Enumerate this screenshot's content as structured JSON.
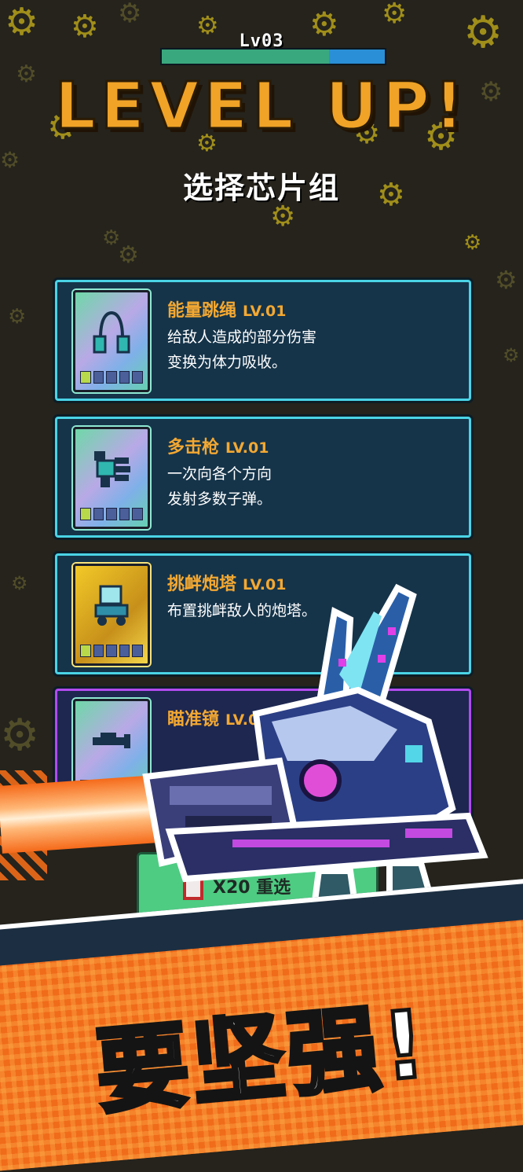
{
  "header": {
    "level_label": "Lv03",
    "xp_progress": 0.75,
    "title": "LEVEL UP!",
    "subtitle": "选择芯片组"
  },
  "cards": [
    {
      "name": "能量跳绳",
      "level": "LV.01",
      "desc_line1": "给敌人造成的部分伤害",
      "desc_line2": "变换为体力吸收。",
      "icon": "jump-rope-icon",
      "slots_filled": 1
    },
    {
      "name": "多击枪",
      "level": "LV.01",
      "desc_line1": "一次向各个方向",
      "desc_line2": "发射多数子弹。",
      "icon": "multi-gun-icon",
      "slots_filled": 1
    },
    {
      "name": "挑衅炮塔",
      "level": "LV.01",
      "desc_line1": "布置挑衅敌人的炮塔。",
      "desc_line2": "",
      "icon": "taunt-turret-icon",
      "slots_filled": 1
    },
    {
      "name": "瞄准镜",
      "level": "LV.03",
      "desc_line1": "",
      "desc_line2": "",
      "icon": "scope-icon",
      "slots_filled": 3
    }
  ],
  "refresh_button": {
    "label": "X20 重选"
  },
  "banner": {
    "slogan": "要坚强!"
  },
  "colors": {
    "accent_orange": "#f0a327",
    "card_border": "#4ad4e6",
    "card_bg": "#15344a",
    "rare_border": "#b34af0"
  }
}
